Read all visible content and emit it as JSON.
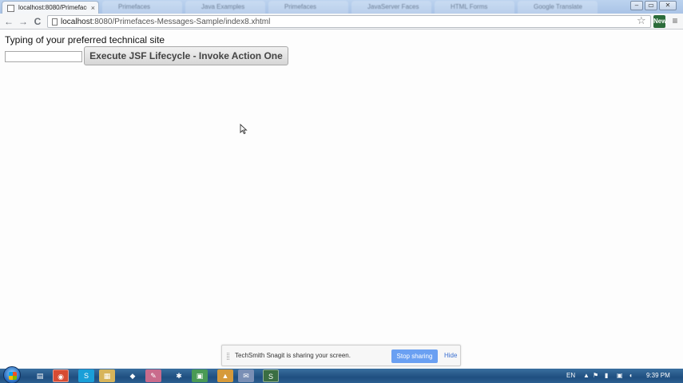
{
  "browser": {
    "active_tab": {
      "title": "localhost:8080/Primefaces",
      "close_glyph": "×"
    },
    "inactive_tabs": [
      {
        "title": "Primefaces"
      },
      {
        "title": "Java Examples"
      },
      {
        "title": "Primefaces"
      },
      {
        "title": "JavaServer Faces"
      },
      {
        "title": "HTML Forms"
      },
      {
        "title": "Google Translate"
      }
    ],
    "window_buttons": {
      "minimize": "–",
      "maximize": "▭",
      "close": "✕"
    },
    "nav": {
      "back": "←",
      "forward": "→",
      "reload": "C"
    },
    "url_host": "localhost",
    "url_rest": ":8080/Primefaces-Messages-Sample/index8.xhtml",
    "star_glyph": "☆",
    "extension_label": "New",
    "menu_glyph": "≡"
  },
  "page": {
    "label": "Typing of your preferred technical site",
    "input_value": "",
    "button_label": "Execute JSF Lifecycle - Invoke Action One"
  },
  "sharebar": {
    "message": "TechSmith Snagit is sharing your screen.",
    "stop_label": "Stop sharing",
    "hide_label": "Hide"
  },
  "taskbar": {
    "icons": [
      {
        "name": "explorer-icon",
        "glyph": "▤"
      },
      {
        "name": "chrome-icon",
        "glyph": "◉"
      },
      {
        "name": "skype-icon",
        "glyph": "S"
      },
      {
        "name": "folder-icon",
        "glyph": "▦"
      },
      {
        "name": "app-icon-1",
        "glyph": "◆"
      },
      {
        "name": "app-icon-2",
        "glyph": "✎"
      },
      {
        "name": "app-icon-3",
        "glyph": "✱"
      },
      {
        "name": "app-icon-4",
        "glyph": "▣"
      },
      {
        "name": "app-icon-5",
        "glyph": "▲"
      },
      {
        "name": "app-icon-6",
        "glyph": "✉"
      },
      {
        "name": "snagit-icon",
        "glyph": "S"
      }
    ],
    "language": "EN",
    "time": "9:39 PM"
  }
}
